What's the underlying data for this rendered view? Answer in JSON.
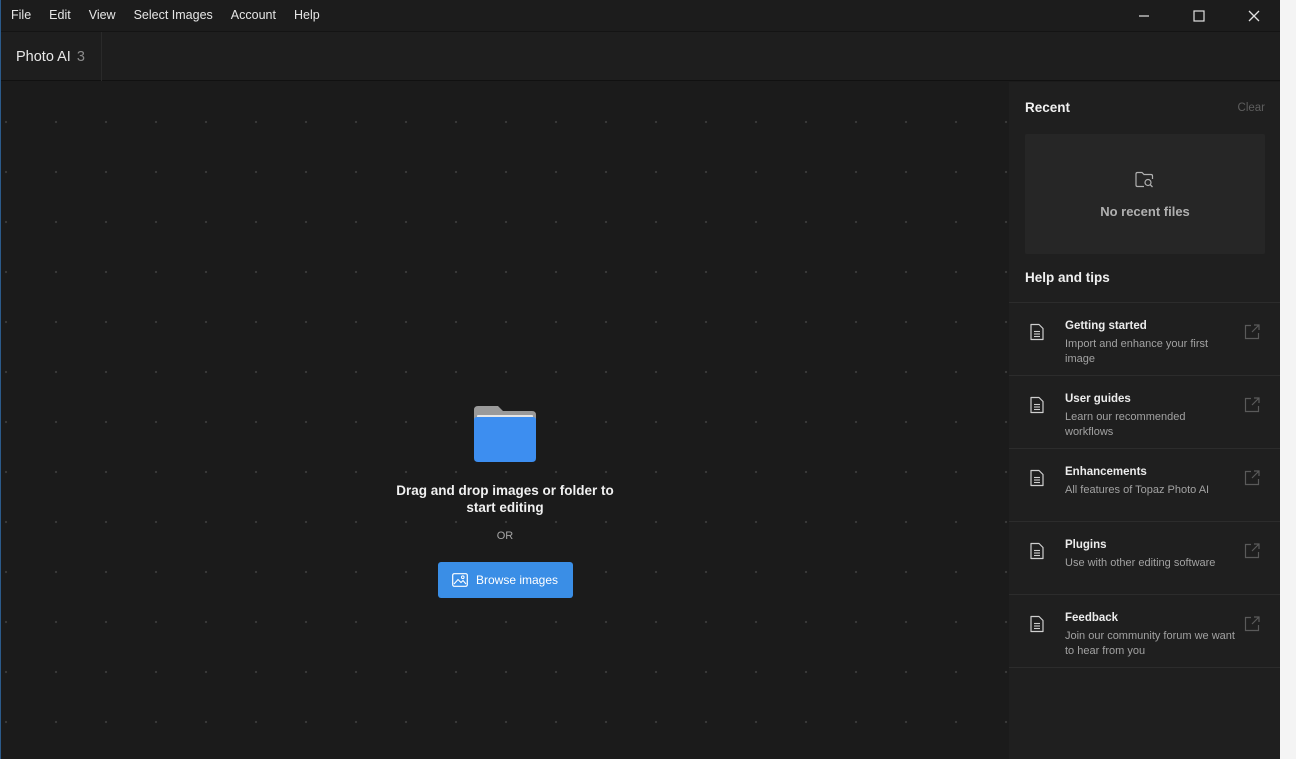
{
  "menu": {
    "items": [
      "File",
      "Edit",
      "View",
      "Select Images",
      "Account",
      "Help"
    ]
  },
  "window_controls": [
    "minimize-icon",
    "maximize-icon",
    "close-icon"
  ],
  "app": {
    "name": "Photo AI",
    "version": "3"
  },
  "dropzone": {
    "icon": "folder-icon",
    "text": "Drag and drop images or folder to start editing",
    "or_text": "OR",
    "browse_label": "Browse images",
    "browse_icon": "image-icon",
    "accent": "#3a8ee6"
  },
  "recent": {
    "title": "Recent",
    "clear_label": "Clear",
    "empty_text": "No recent files",
    "empty_icon": "folder-search-icon"
  },
  "help": {
    "title": "Help and tips",
    "items": [
      {
        "title": "Getting started",
        "desc": "Import and enhance your first image"
      },
      {
        "title": "User guides",
        "desc": "Learn our recommended workflows"
      },
      {
        "title": "Enhancements",
        "desc": "All features of Topaz Photo AI"
      },
      {
        "title": "Plugins",
        "desc": "Use with other editing software"
      },
      {
        "title": "Feedback",
        "desc": "Join our community forum we want to hear from you"
      }
    ]
  }
}
